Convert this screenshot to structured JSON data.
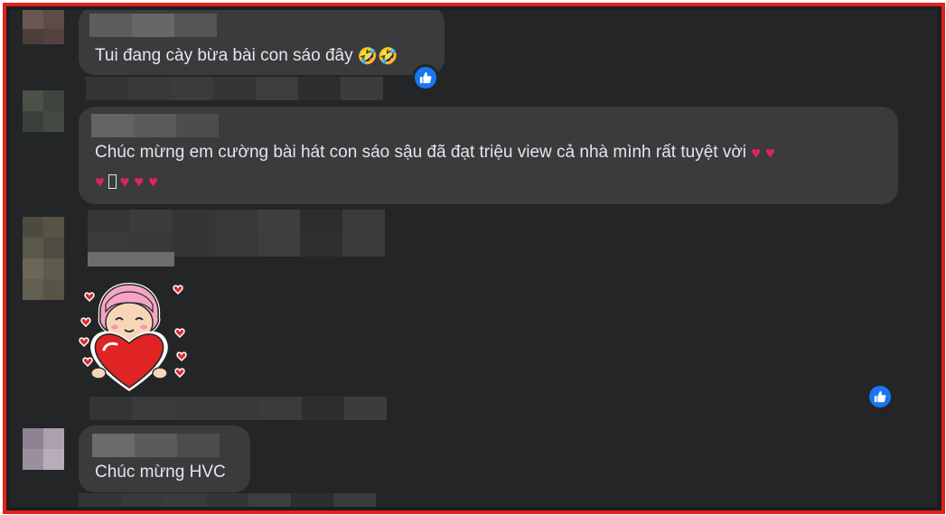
{
  "comments": [
    {
      "text": "Tui đang cày bừa bài con sáo đây",
      "emoji": "🤣🤣"
    },
    {
      "text_line1": "Chúc mừng em cường bài hát con sáo sậu đã đạt triệu view cả nhà mình rất tuyệt vời",
      "hearts_line1": "♥ ♥",
      "hearts_line2_before": "♥",
      "hearts_line2_after": "♥ ♥ ♥"
    },
    {
      "sticker": "girl-holding-heart-sticker"
    },
    {
      "text": "Chúc mừng HVC"
    }
  ],
  "colors": {
    "frame": "#e3201b",
    "background": "#242526",
    "bubble": "#3a3b3c",
    "text": "#e4e6eb",
    "like": "#1877f2"
  }
}
